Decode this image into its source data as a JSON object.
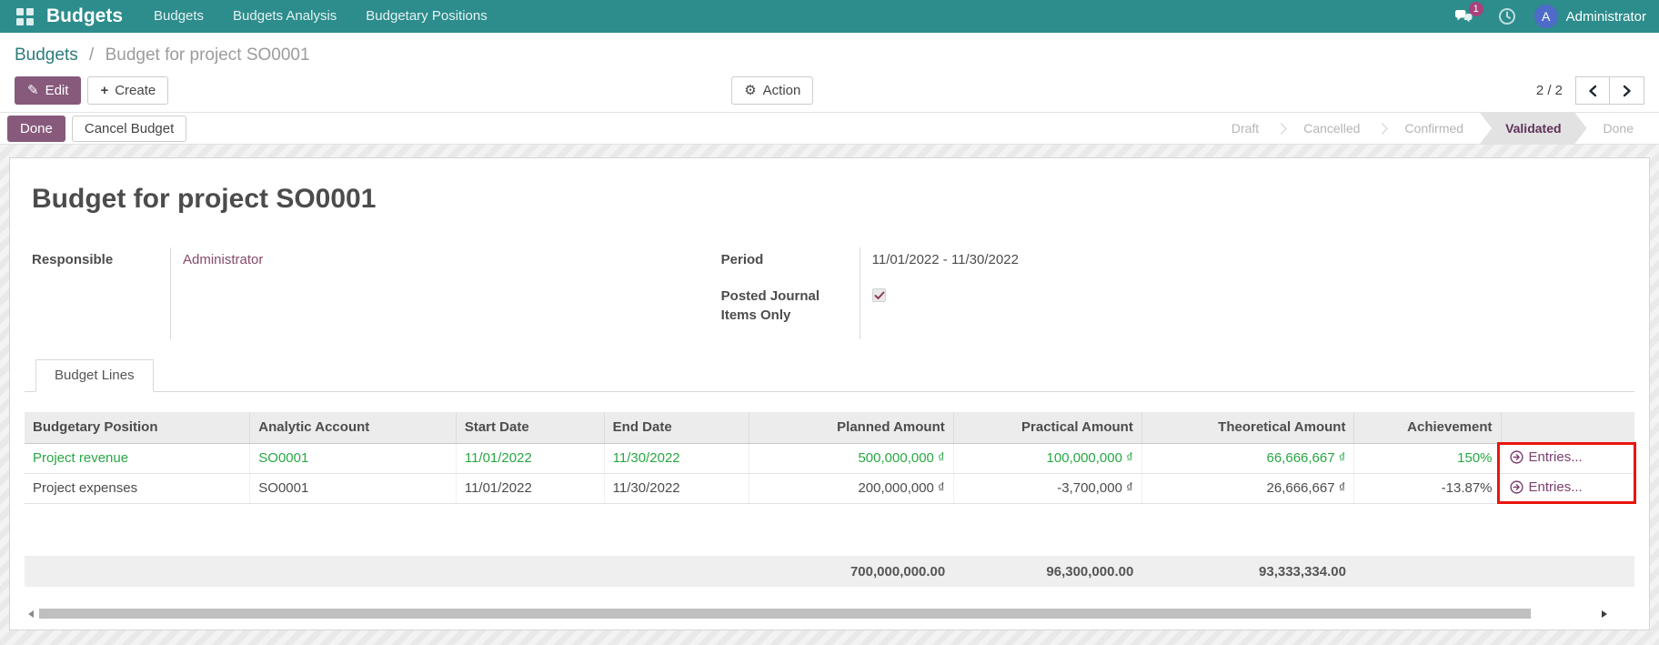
{
  "navbar": {
    "brand": "Budgets",
    "menus": [
      "Budgets",
      "Budgets Analysis",
      "Budgetary Positions"
    ],
    "messages_badge": "1",
    "user": {
      "initial": "A",
      "name": "Administrator"
    }
  },
  "control_panel": {
    "breadcrumb_parent": "Budgets",
    "breadcrumb_separator": "/",
    "breadcrumb_current": "Budget for project SO0001",
    "edit_label": "Edit",
    "create_label": "Create",
    "action_label": "Action",
    "pager": "2 / 2"
  },
  "statusbar": {
    "done_label": "Done",
    "cancel_label": "Cancel Budget",
    "states": [
      "Draft",
      "Cancelled",
      "Confirmed",
      "Validated",
      "Done"
    ],
    "active_state": "Validated"
  },
  "form": {
    "title": "Budget for project SO0001",
    "responsible_label": "Responsible",
    "responsible_value": "Administrator",
    "period_label": "Period",
    "period_value": "11/01/2022 - 11/30/2022",
    "posted_label": "Posted Journal Items Only",
    "posted_checked": true
  },
  "notebook": {
    "active_tab": "Budget Lines"
  },
  "budget_lines": {
    "headers": [
      "Budgetary Position",
      "Analytic Account",
      "Start Date",
      "End Date",
      "Planned Amount",
      "Practical Amount",
      "Theoretical Amount",
      "Achievement",
      ""
    ],
    "rows": [
      {
        "budgetary_position": "Project revenue",
        "analytic_account": "SO0001",
        "start_date": "11/01/2022",
        "end_date": "11/30/2022",
        "planned_amount": "500,000,000 ₫",
        "practical_amount": "100,000,000 ₫",
        "theoretical_amount": "66,666,667 ₫",
        "achievement": "150%",
        "entries_label": "Entries...",
        "highlight": "green"
      },
      {
        "budgetary_position": "Project expenses",
        "analytic_account": "SO0001",
        "start_date": "11/01/2022",
        "end_date": "11/30/2022",
        "planned_amount": "200,000,000 ₫",
        "practical_amount": "-3,700,000 ₫",
        "theoretical_amount": "26,666,667 ₫",
        "achievement": "-13.87%",
        "entries_label": "Entries...",
        "highlight": "none"
      }
    ],
    "totals": {
      "planned": "700,000,000.00",
      "practical": "96,300,000.00",
      "theoretical": "93,333,334.00"
    }
  },
  "icons": {
    "edit": "✎",
    "action": "⚙",
    "create": "+"
  },
  "colors": {
    "navbar_teal": "#2d8c8c",
    "primary_purple": "#875a7b",
    "row_highlight_green": "#28a745",
    "link_purple": "#874a6d",
    "annotation_red": "#e8150f",
    "active_state_text": "#5e3257",
    "avatar_blue": "#4f6bc8",
    "badge_magenta": "#a8427c"
  }
}
